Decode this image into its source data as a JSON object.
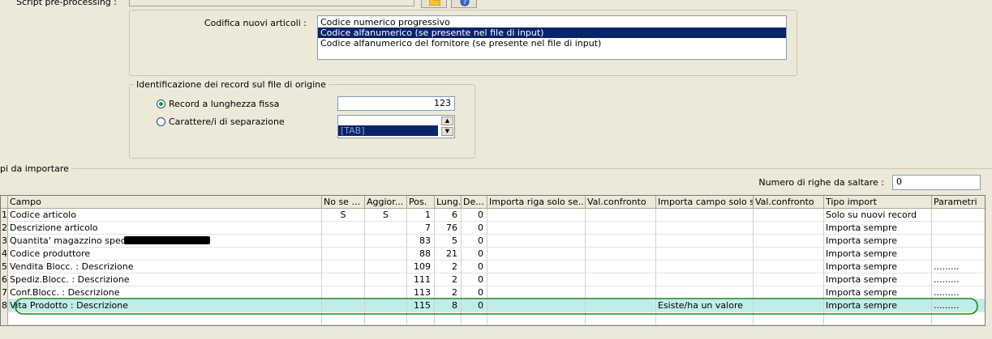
{
  "top": {
    "script_label": "Script pre-processing :"
  },
  "codifica": {
    "label": "Codifica nuovi articoli :",
    "options": [
      "Codice numerico progressivo",
      "Codice alfanumerico (se presente nel file di input)",
      "Codice alfanumerico del fornitore (se presente nel file di input)"
    ],
    "selected_index": 1
  },
  "identificazione": {
    "legend": "Identificazione dei record sul file di origine",
    "fixed_label": "Record a lunghezza fissa",
    "fixed_value": "123",
    "sep_label": "Carattere/i di separazione",
    "sep_options": [
      "",
      "[TAB]"
    ],
    "selected": "fixed"
  },
  "campi": {
    "legend": "pi da importare",
    "skip_label": "Numero di righe da saltare :",
    "skip_value": "0"
  },
  "grid": {
    "columns": [
      "Campo",
      "No se ...",
      "Aggior...",
      "Pos.",
      "Lung.",
      "De...",
      "Importa riga solo se...",
      "Val.confronto",
      "Importa campo solo s...",
      "Val.confronto",
      "Tipo import",
      "Parametri"
    ],
    "rows": [
      {
        "n": "1",
        "campo": "Codice articolo",
        "nose": "S",
        "agg": "S",
        "pos": "1",
        "lung": "6",
        "dec": "0",
        "imp_riga": "",
        "val1": "",
        "imp_campo": "",
        "val2": "",
        "tipo": "Solo su nuovi record",
        "param": ""
      },
      {
        "n": "2",
        "campo": "Descrizione articolo",
        "nose": "",
        "agg": "",
        "pos": "7",
        "lung": "76",
        "dec": "0",
        "imp_riga": "",
        "val1": "",
        "imp_campo": "",
        "val2": "",
        "tipo": "Importa sempre",
        "param": ""
      },
      {
        "n": "3",
        "campo": "Quantita' magazzino specifico",
        "nose": "",
        "agg": "",
        "pos": "83",
        "lung": "5",
        "dec": "0",
        "imp_riga": "",
        "val1": "",
        "imp_campo": "",
        "val2": "",
        "tipo": "Importa sempre",
        "param": ""
      },
      {
        "n": "4",
        "campo": "Codice produttore",
        "nose": "",
        "agg": "",
        "pos": "88",
        "lung": "21",
        "dec": "0",
        "imp_riga": "",
        "val1": "",
        "imp_campo": "",
        "val2": "",
        "tipo": "Importa sempre",
        "param": ""
      },
      {
        "n": "5",
        "campo": "Vendita Blocc. : Descrizione",
        "nose": "",
        "agg": "",
        "pos": "109",
        "lung": "2",
        "dec": "0",
        "imp_riga": "",
        "val1": "",
        "imp_campo": "",
        "val2": "",
        "tipo": "Importa sempre",
        "param": "........."
      },
      {
        "n": "6",
        "campo": "Spediz.Blocc. : Descrizione",
        "nose": "",
        "agg": "",
        "pos": "111",
        "lung": "2",
        "dec": "0",
        "imp_riga": "",
        "val1": "",
        "imp_campo": "",
        "val2": "",
        "tipo": "Importa sempre",
        "param": "........."
      },
      {
        "n": "7",
        "campo": "Conf.Blocc. : Descrizione",
        "nose": "",
        "agg": "",
        "pos": "113",
        "lung": "2",
        "dec": "0",
        "imp_riga": "",
        "val1": "",
        "imp_campo": "",
        "val2": "",
        "tipo": "Importa sempre",
        "param": "........."
      },
      {
        "n": "8",
        "campo": "Vita Prodotto : Descrizione",
        "nose": "",
        "agg": "",
        "pos": "115",
        "lung": "8",
        "dec": "0",
        "imp_riga": "",
        "val1": "",
        "imp_campo": "Esiste/ha un valore",
        "val2": "",
        "tipo": "Importa sempre",
        "param": "........."
      }
    ],
    "highlighted_row": 7,
    "highlight_color": "#bfeeea",
    "circle_color": "#1a8a1a"
  },
  "colors": {
    "selection": "#0a246a",
    "background": "#ece9d8"
  }
}
